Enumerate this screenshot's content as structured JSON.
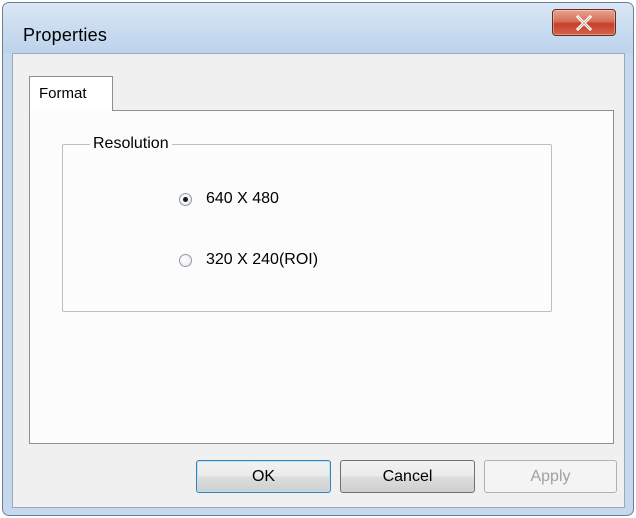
{
  "window": {
    "title": "Properties"
  },
  "tabs": [
    {
      "label": "Format",
      "selected": true
    }
  ],
  "resolution_group": {
    "label": "Resolution",
    "options": [
      {
        "label": "640 X 480",
        "selected": true
      },
      {
        "label": "320 X 240(ROI)",
        "selected": false
      }
    ]
  },
  "buttons": {
    "ok_label": "OK",
    "cancel_label": "Cancel",
    "apply_label": "Apply",
    "apply_enabled": false
  },
  "icons": {
    "close": "close-icon"
  },
  "colors": {
    "title_bar": "#c8dbf0",
    "close_button": "#c4412a",
    "dialog_background": "#f0f0f0",
    "tab_panel": "#fcfcfc",
    "disabled_text": "#a0a0a0"
  }
}
